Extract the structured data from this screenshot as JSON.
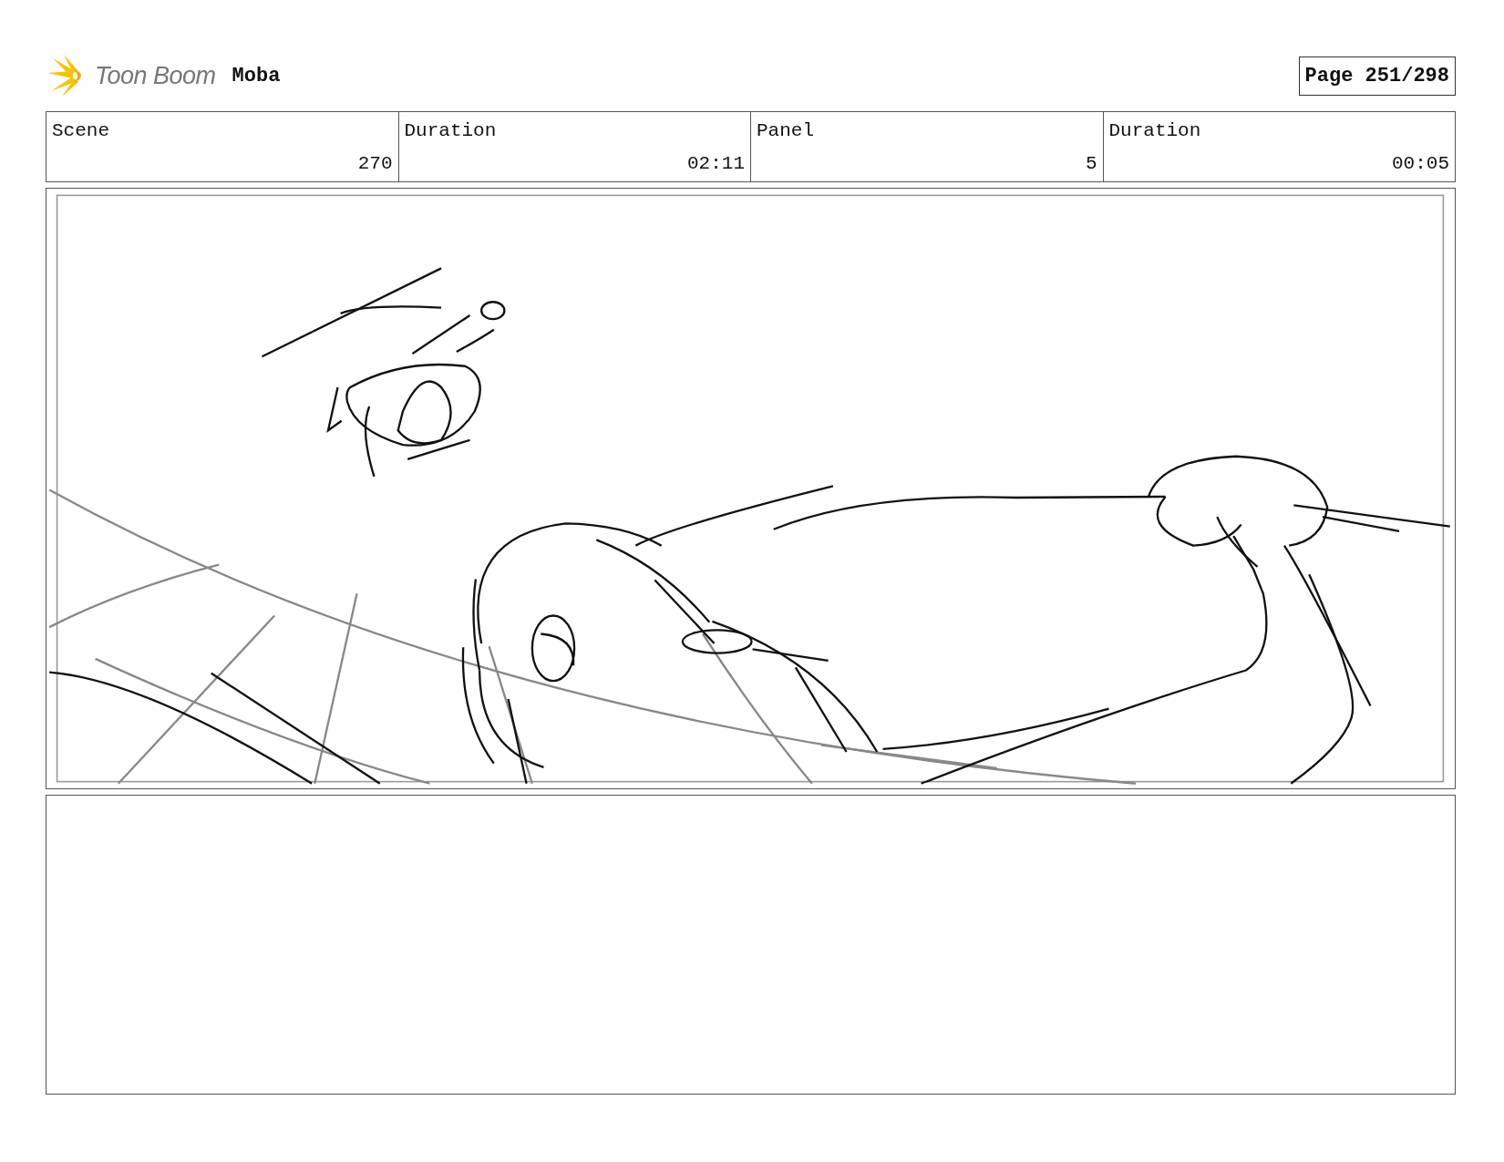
{
  "header": {
    "logo_text": "Toon Boom",
    "project": "Moba",
    "page": "Page 251/298"
  },
  "info_table": {
    "columns": [
      "Scene",
      "Duration",
      "Panel",
      "Duration"
    ],
    "rows": [
      [
        "270",
        "02:11",
        "5",
        "00:05"
      ]
    ]
  }
}
